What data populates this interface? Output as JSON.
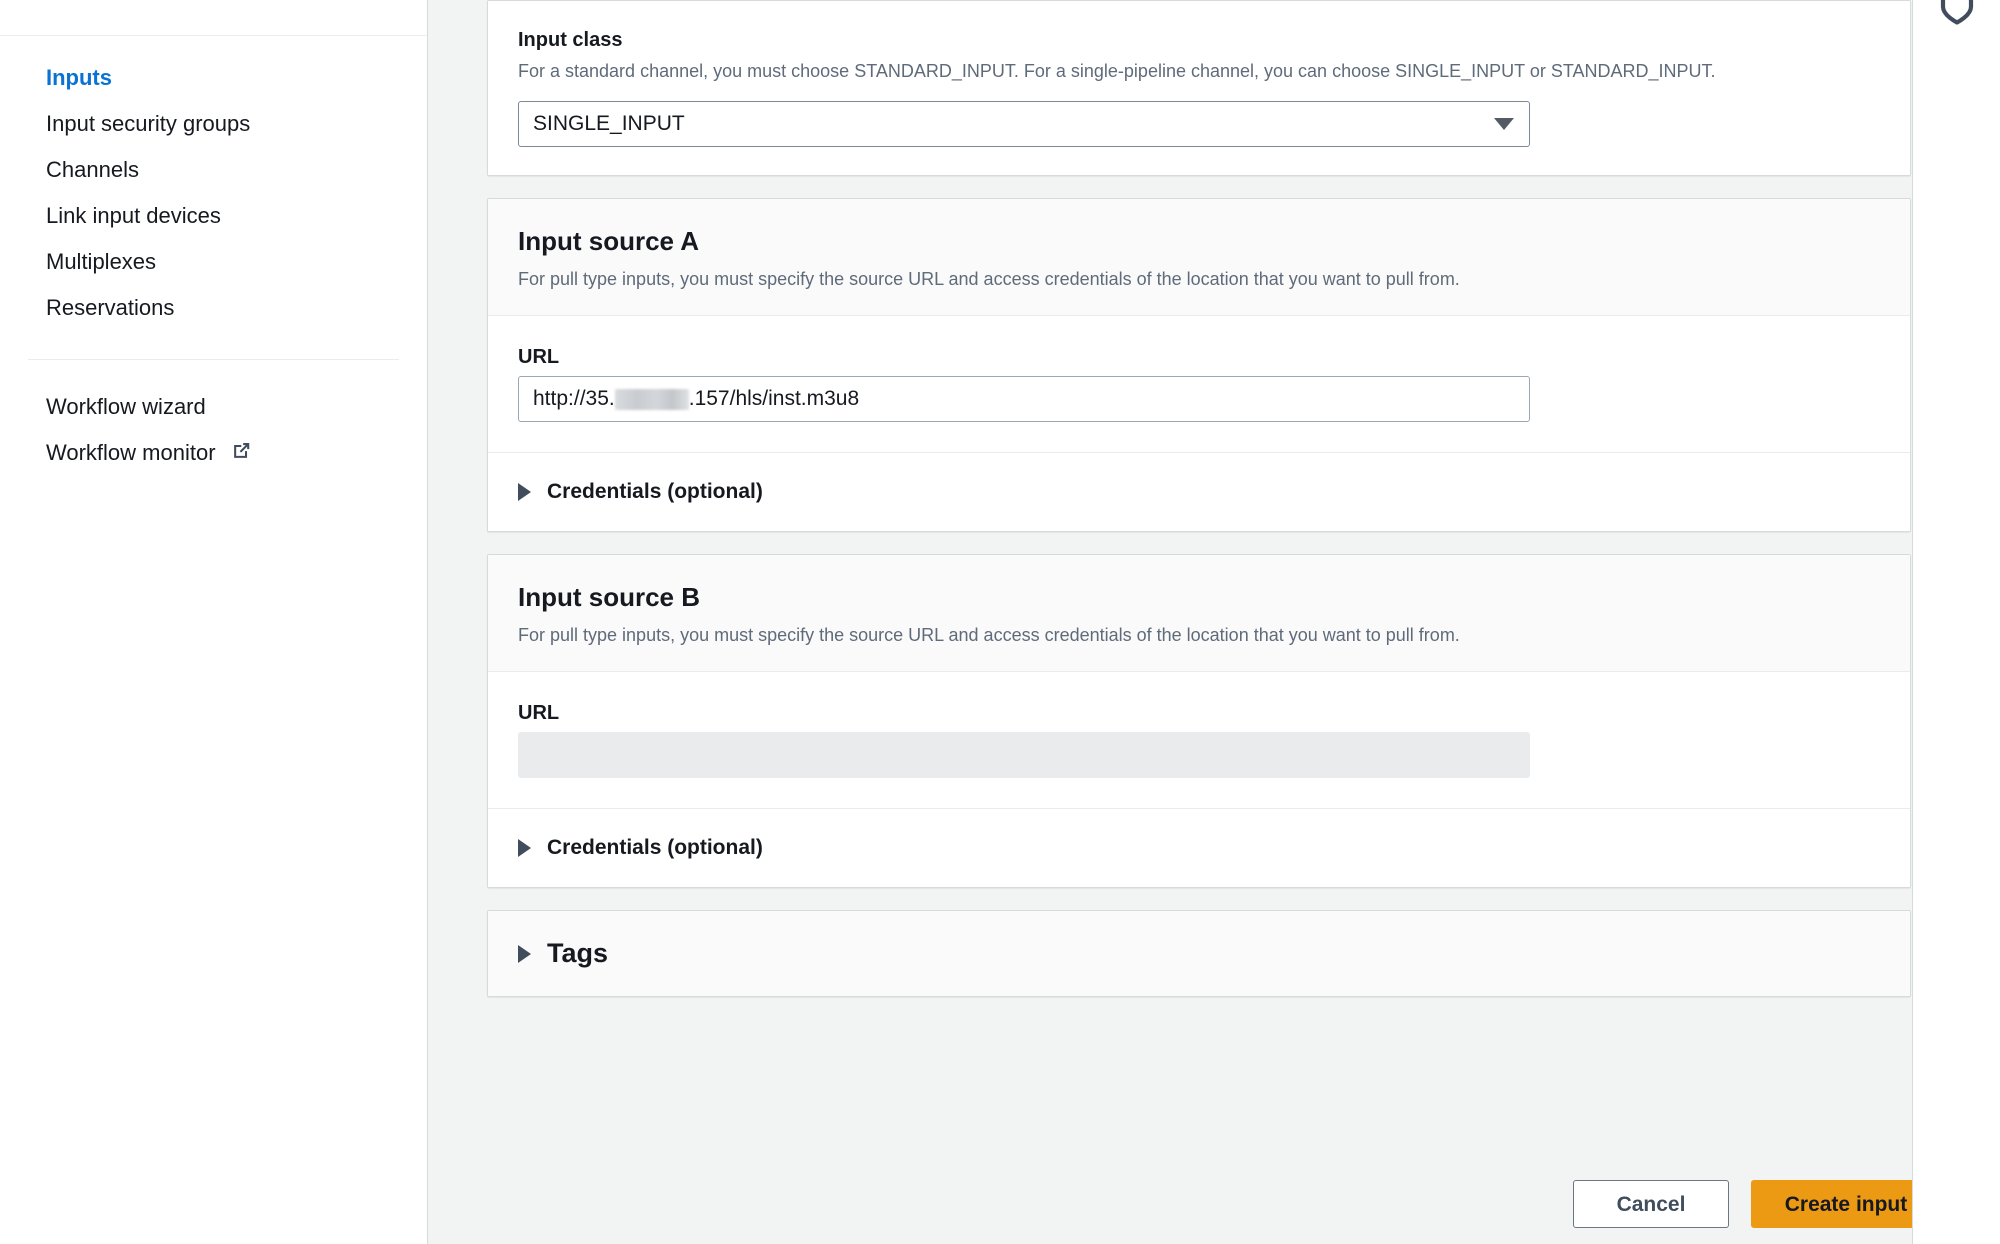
{
  "sidebar": {
    "items": [
      {
        "label": "Inputs",
        "active": true,
        "external": false
      },
      {
        "label": "Input security groups",
        "active": false,
        "external": false
      },
      {
        "label": "Channels",
        "active": false,
        "external": false
      },
      {
        "label": "Link input devices",
        "active": false,
        "external": false
      },
      {
        "label": "Multiplexes",
        "active": false,
        "external": false
      },
      {
        "label": "Reservations",
        "active": false,
        "external": false
      }
    ],
    "secondary_items": [
      {
        "label": "Workflow wizard",
        "external": false
      },
      {
        "label": "Workflow monitor",
        "external": true
      }
    ]
  },
  "input_class": {
    "label": "Input class",
    "description": "For a standard channel, you must choose STANDARD_INPUT. For a single-pipeline channel, you can choose SINGLE_INPUT or STANDARD_INPUT.",
    "selected": "SINGLE_INPUT",
    "options": [
      "SINGLE_INPUT",
      "STANDARD_INPUT"
    ]
  },
  "source_a": {
    "title": "Input source A",
    "description": "For pull type inputs, you must specify the source URL and access credentials of the location that you want to pull from.",
    "url_label": "URL",
    "url_prefix": "http://35.",
    "url_suffix": ".157/hls/inst.m3u8",
    "url_redacted": true,
    "credentials_label": "Credentials (optional)",
    "credentials_expanded": false
  },
  "source_b": {
    "title": "Input source B",
    "description": "For pull type inputs, you must specify the source URL and access credentials of the location that you want to pull from.",
    "url_label": "URL",
    "url_value": "",
    "url_disabled": true,
    "credentials_label": "Credentials (optional)",
    "credentials_expanded": false
  },
  "tags": {
    "label": "Tags",
    "expanded": false
  },
  "footer": {
    "cancel_label": "Cancel",
    "create_label": "Create input"
  },
  "colors": {
    "accent_link": "#0972d3",
    "primary_button": "#ec9a14",
    "page_background": "#f2f3f3",
    "card_background": "#ffffff",
    "card_header_background": "#fafafa",
    "border": "#d5dbdb",
    "text": "#16191f",
    "muted_text": "#5f6b7a"
  },
  "icons": {
    "external_link": "external-link-icon",
    "dropdown_caret": "chevron-down-icon",
    "expander_triangle": "triangle-right-icon",
    "help_panel": "help-panel-icon"
  }
}
